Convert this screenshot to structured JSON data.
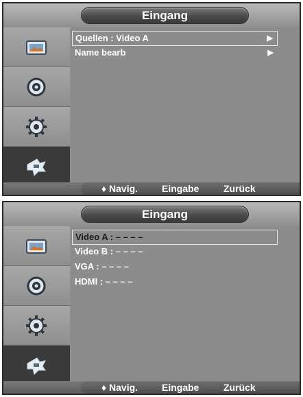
{
  "screens": [
    {
      "title": "Eingang",
      "items": [
        {
          "label": "Quellen  :  Video A",
          "arrow": "▶"
        },
        {
          "label": "Name bearb",
          "arrow": "▶"
        }
      ],
      "footer": {
        "nav": "♦ Navig.",
        "enter": "Eingabe",
        "back": "Zurück"
      }
    },
    {
      "title": "Eingang",
      "items": [
        {
          "label": "Video A : – – – –"
        },
        {
          "label": "Video B : – – – –"
        },
        {
          "label": "VGA : – – – –"
        },
        {
          "label": "HDMI : – – – –"
        }
      ],
      "footer": {
        "nav": "♦ Navig.",
        "enter": "Eingabe",
        "back": "Zurück"
      }
    }
  ],
  "sidebar_icons": [
    "picture-icon",
    "sound-icon",
    "setup-icon",
    "input-icon"
  ],
  "colors": {
    "panel": "#8c8c8c",
    "title_pill": "#4a4a4a",
    "active_sidebar": "#3a3a3a",
    "text": "#ffffff"
  }
}
